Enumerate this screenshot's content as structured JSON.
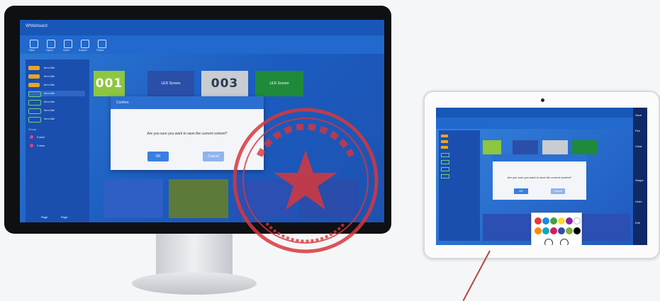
{
  "desktop": {
    "app_title": "Whiteboard",
    "toolbar_items": [
      "New",
      "Open",
      "Save",
      "Export",
      "Share"
    ],
    "sidebar_items": [
      "Item title",
      "Item title",
      "Item title",
      "Item title",
      "Item title",
      "Item title",
      "Item title"
    ],
    "sidebar_section": "Group",
    "sidebar_extra": [
      "Folder",
      "Folder"
    ],
    "tiles": [
      {
        "text": "001",
        "color": "#8dc63f",
        "big": true
      },
      {
        "text": "LED Screen",
        "color": "#2a4fa8",
        "big": false
      },
      {
        "text": "003",
        "color": "#c9ccd1",
        "big": true
      },
      {
        "text": "LED Screen",
        "color": "#1f8a3a",
        "big": false
      }
    ],
    "dialog": {
      "title": "Confirm",
      "message": "Are you sure you want to save the current content?",
      "ok": "OK",
      "cancel": "Cancel"
    },
    "bottom_tabs": [
      "Page",
      "Page"
    ]
  },
  "tablet": {
    "dialog_message": "Are you sure you want to save the current content?",
    "ok": "OK",
    "cancel": "Cancel",
    "rail_labels": [
      "Save",
      "Pen",
      "Clear",
      "Shape",
      "Undo",
      "Exit"
    ],
    "palette_colors": [
      "#e53935",
      "#1e88e5",
      "#43a047",
      "#fdd835",
      "#8e24aa",
      "#ffffff",
      "#fb8c00",
      "#00acc1",
      "#d81b60",
      "#3949ab",
      "#7cb342",
      "#000000"
    ]
  },
  "colors": {
    "stamp": "#d7373b",
    "screen_blue": "#1b5bbf"
  }
}
